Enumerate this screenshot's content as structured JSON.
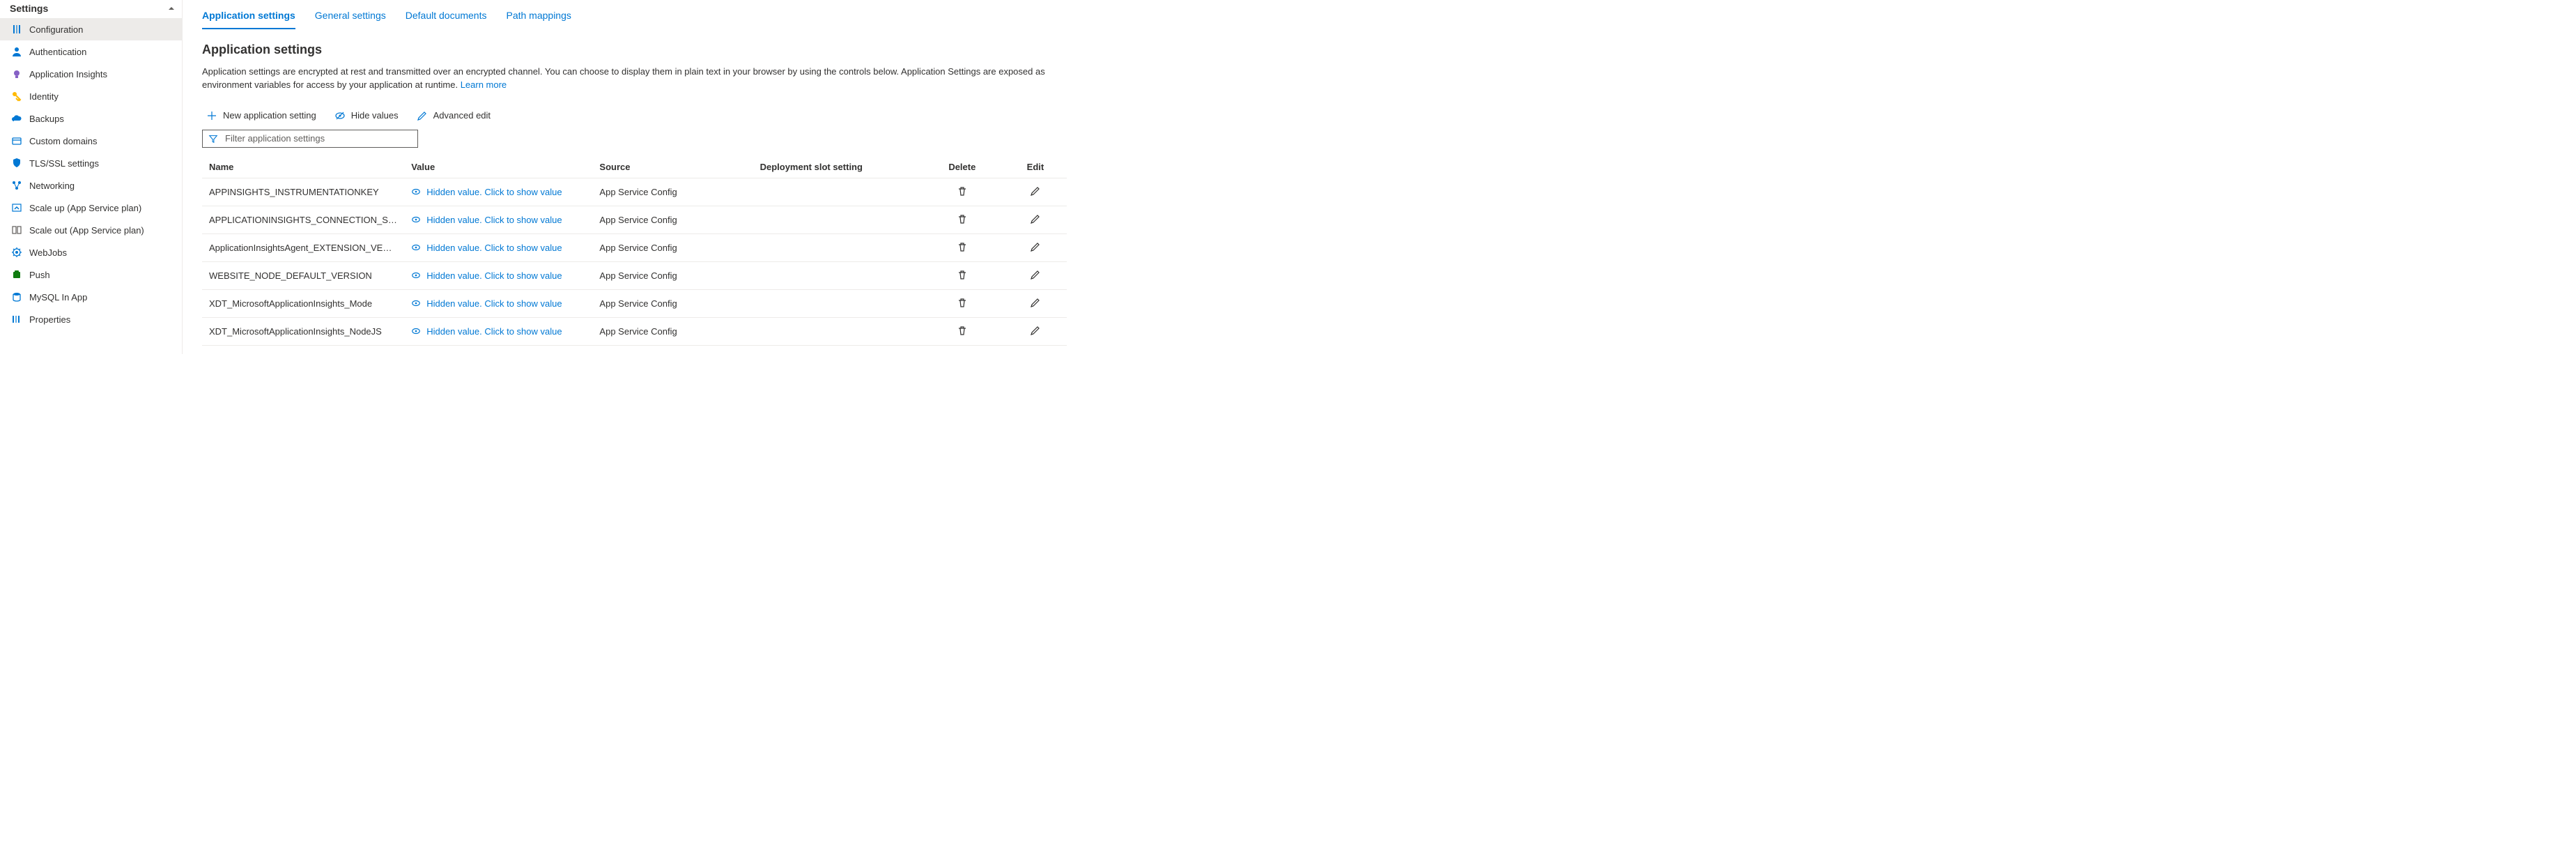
{
  "sidebar": {
    "title": "Settings",
    "items": [
      {
        "label": "Configuration",
        "icon": "sliders",
        "color": "#0078d4",
        "active": true
      },
      {
        "label": "Authentication",
        "icon": "person",
        "color": "#0078d4",
        "active": false
      },
      {
        "label": "Application Insights",
        "icon": "bulb",
        "color": "#8661c5",
        "active": false
      },
      {
        "label": "Identity",
        "icon": "key",
        "color": "#ffb900",
        "active": false
      },
      {
        "label": "Backups",
        "icon": "cloud",
        "color": "#0078d4",
        "active": false
      },
      {
        "label": "Custom domains",
        "icon": "domain",
        "color": "#0078d4",
        "active": false
      },
      {
        "label": "TLS/SSL settings",
        "icon": "shield",
        "color": "#0078d4",
        "active": false
      },
      {
        "label": "Networking",
        "icon": "network",
        "color": "#0078d4",
        "active": false
      },
      {
        "label": "Scale up (App Service plan)",
        "icon": "scaleup",
        "color": "#0078d4",
        "active": false
      },
      {
        "label": "Scale out (App Service plan)",
        "icon": "scaleout",
        "color": "#605e5c",
        "active": false
      },
      {
        "label": "WebJobs",
        "icon": "webjobs",
        "color": "#0078d4",
        "active": false
      },
      {
        "label": "Push",
        "icon": "push",
        "color": "#107c10",
        "active": false
      },
      {
        "label": "MySQL In App",
        "icon": "mysql",
        "color": "#0078d4",
        "active": false
      },
      {
        "label": "Properties",
        "icon": "properties",
        "color": "#0078d4",
        "active": false
      }
    ]
  },
  "tabs": [
    {
      "label": "Application settings",
      "active": true
    },
    {
      "label": "General settings",
      "active": false
    },
    {
      "label": "Default documents",
      "active": false
    },
    {
      "label": "Path mappings",
      "active": false
    }
  ],
  "section": {
    "title": "Application settings",
    "description_prefix": "Application settings are encrypted at rest and transmitted over an encrypted channel. You can choose to display them in plain text in your browser by using the controls below. Application Settings are exposed as environment variables for access by your application at runtime. ",
    "learn_more": "Learn more"
  },
  "toolbar": {
    "new_setting": "New application setting",
    "hide_values": "Hide values",
    "advanced_edit": "Advanced edit"
  },
  "filter": {
    "placeholder": "Filter application settings"
  },
  "table": {
    "headers": {
      "name": "Name",
      "value": "Value",
      "source": "Source",
      "slot": "Deployment slot setting",
      "delete": "Delete",
      "edit": "Edit"
    },
    "hidden_value_text": "Hidden value. Click to show value",
    "rows": [
      {
        "name": "APPINSIGHTS_INSTRUMENTATIONKEY",
        "source": "App Service Config"
      },
      {
        "name": "APPLICATIONINSIGHTS_CONNECTION_STRING",
        "source": "App Service Config"
      },
      {
        "name": "ApplicationInsightsAgent_EXTENSION_VERSION",
        "source": "App Service Config"
      },
      {
        "name": "WEBSITE_NODE_DEFAULT_VERSION",
        "source": "App Service Config"
      },
      {
        "name": "XDT_MicrosoftApplicationInsights_Mode",
        "source": "App Service Config"
      },
      {
        "name": "XDT_MicrosoftApplicationInsights_NodeJS",
        "source": "App Service Config"
      }
    ]
  }
}
